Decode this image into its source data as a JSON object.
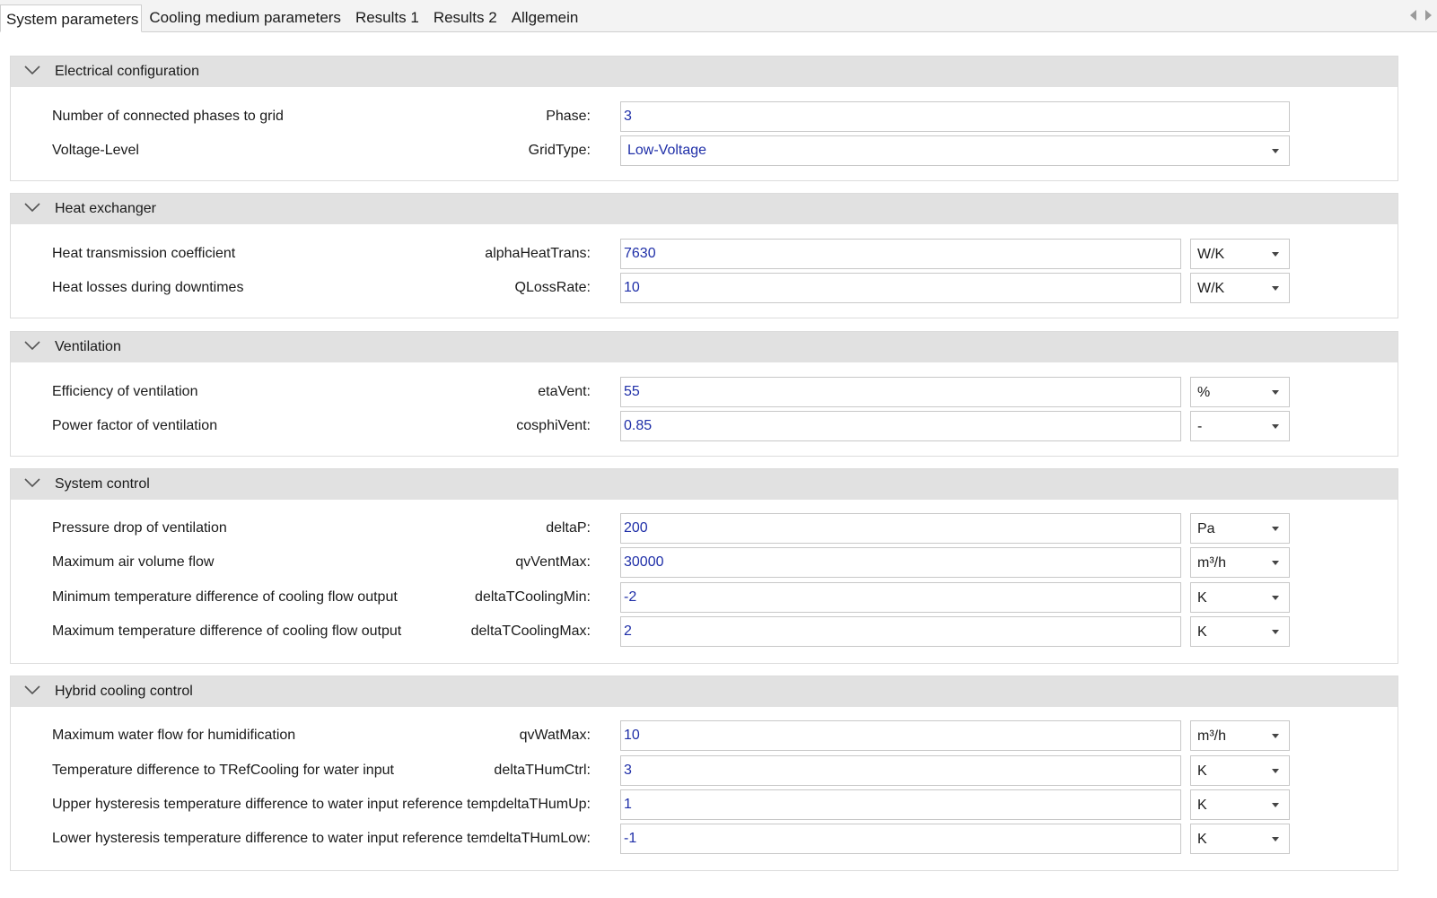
{
  "tabs": [
    {
      "label": "System parameters"
    },
    {
      "label": "Cooling medium parameters"
    },
    {
      "label": "Results 1"
    },
    {
      "label": "Results 2"
    },
    {
      "label": "Allgemein"
    }
  ],
  "sections": [
    {
      "title": "Electrical configuration",
      "rows": [
        {
          "description": "Number of connected phases to grid",
          "param": "Phase:",
          "value": "3"
        },
        {
          "description": "Voltage-Level",
          "param": "GridType:",
          "value": "Low-Voltage"
        }
      ]
    },
    {
      "title": "Heat exchanger",
      "rows": [
        {
          "description": "Heat transmission coefficient",
          "param": "alphaHeatTrans:",
          "value": "7630",
          "unit": "W/K"
        },
        {
          "description": "Heat losses during downtimes",
          "param": "QLossRate:",
          "value": "10",
          "unit": "W/K"
        }
      ]
    },
    {
      "title": "Ventilation",
      "rows": [
        {
          "description": "Efficiency of ventilation",
          "param": "etaVent:",
          "value": "55",
          "unit": "%"
        },
        {
          "description": "Power factor of ventilation",
          "param": "cosphiVent:",
          "value": "0.85",
          "unit": "-"
        }
      ]
    },
    {
      "title": "System control",
      "rows": [
        {
          "description": "Pressure drop of ventilation",
          "param": "deltaP:",
          "value": "200",
          "unit": "Pa"
        },
        {
          "description": "Maximum air volume flow",
          "param": "qvVentMax:",
          "value": "30000",
          "unit": "m³/h"
        },
        {
          "description": "Minimum temperature difference of cooling flow output",
          "param": "deltaTCoolingMin:",
          "value": "-2",
          "unit": "K"
        },
        {
          "description": "Maximum temperature difference of cooling flow output",
          "param": "deltaTCoolingMax:",
          "value": "2",
          "unit": "K"
        }
      ]
    },
    {
      "title": "Hybrid cooling control",
      "rows": [
        {
          "description": "Maximum water flow for humidification",
          "param": "qvWatMax:",
          "value": "10",
          "unit": "m³/h"
        },
        {
          "description": "Temperature difference to TRefCooling for water input",
          "param": "deltaTHumCtrl:",
          "value": "3",
          "unit": "K"
        },
        {
          "description": "Upper hysteresis temperature difference to water input reference temper...",
          "param": "deltaTHumUp:",
          "value": "1",
          "unit": "K"
        },
        {
          "description": "Lower hysteresis temperature difference to water input reference temp...",
          "param": "deltaTHumLow:",
          "value": "-1",
          "unit": "K"
        }
      ]
    }
  ],
  "colors": {
    "value_text": "#1f2fa8",
    "section_header_bg": "#e1e1e1"
  }
}
